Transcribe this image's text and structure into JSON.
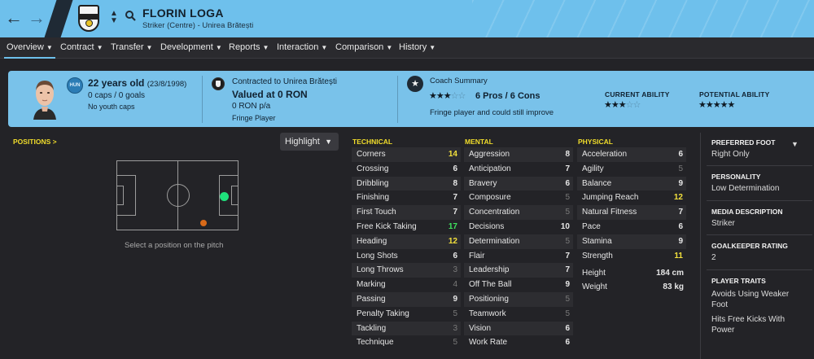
{
  "header": {
    "player_name": "FLORIN LOGA",
    "subtitle": "Striker (Centre) - Unirea Brătești",
    "header_color": "#6ec0ec"
  },
  "tabs": [
    {
      "label": "Overview",
      "active": true
    },
    {
      "label": "Contract"
    },
    {
      "label": "Transfer"
    },
    {
      "label": "Development"
    },
    {
      "label": "Reports"
    },
    {
      "label": "Interaction"
    },
    {
      "label": "Comparison"
    },
    {
      "label": "History"
    }
  ],
  "banner": {
    "nation_code": "HUN",
    "age": "22 years old",
    "dob": "(23/8/1998)",
    "caps": "0 caps / 0 goals",
    "youth_caps": "No youth caps",
    "contract": "Contracted to Unirea Brătești",
    "value": "Valued at 0 RON",
    "wage": "0 RON p/a",
    "status": "Fringe Player",
    "coach_title": "Coach Summary",
    "coach_stars": 3,
    "coach_pros_cons": "6 Pros / 6 Cons",
    "coach_summary": "Fringe player and could still improve",
    "current_ability_label": "CURRENT ABILITY",
    "current_ability_stars": 3,
    "potential_ability_label": "POTENTIAL ABILITY",
    "potential_ability_stars": 5
  },
  "positions": {
    "title": "POSITIONS >",
    "highlight_label": "Highlight",
    "hint": "Select a position on the pitch"
  },
  "technical": {
    "title": "TECHNICAL",
    "attrs": [
      {
        "name": "Corners",
        "value": "14"
      },
      {
        "name": "Crossing",
        "value": "6"
      },
      {
        "name": "Dribbling",
        "value": "8"
      },
      {
        "name": "Finishing",
        "value": "7"
      },
      {
        "name": "First Touch",
        "value": "7"
      },
      {
        "name": "Free Kick Taking",
        "value": "17"
      },
      {
        "name": "Heading",
        "value": "12"
      },
      {
        "name": "Long Shots",
        "value": "6"
      },
      {
        "name": "Long Throws",
        "value": "3"
      },
      {
        "name": "Marking",
        "value": "4"
      },
      {
        "name": "Passing",
        "value": "9"
      },
      {
        "name": "Penalty Taking",
        "value": "5"
      },
      {
        "name": "Tackling",
        "value": "3"
      },
      {
        "name": "Technique",
        "value": "5"
      }
    ]
  },
  "mental": {
    "title": "MENTAL",
    "attrs": [
      {
        "name": "Aggression",
        "value": "8"
      },
      {
        "name": "Anticipation",
        "value": "7"
      },
      {
        "name": "Bravery",
        "value": "6"
      },
      {
        "name": "Composure",
        "value": "5"
      },
      {
        "name": "Concentration",
        "value": "5"
      },
      {
        "name": "Decisions",
        "value": "10"
      },
      {
        "name": "Determination",
        "value": "5"
      },
      {
        "name": "Flair",
        "value": "7"
      },
      {
        "name": "Leadership",
        "value": "7"
      },
      {
        "name": "Off The Ball",
        "value": "9"
      },
      {
        "name": "Positioning",
        "value": "5"
      },
      {
        "name": "Teamwork",
        "value": "5"
      },
      {
        "name": "Vision",
        "value": "6"
      },
      {
        "name": "Work Rate",
        "value": "6"
      }
    ]
  },
  "physical": {
    "title": "PHYSICAL",
    "attrs": [
      {
        "name": "Acceleration",
        "value": "6"
      },
      {
        "name": "Agility",
        "value": "5"
      },
      {
        "name": "Balance",
        "value": "9"
      },
      {
        "name": "Jumping Reach",
        "value": "12"
      },
      {
        "name": "Natural Fitness",
        "value": "7"
      },
      {
        "name": "Pace",
        "value": "6"
      },
      {
        "name": "Stamina",
        "value": "9"
      },
      {
        "name": "Strength",
        "value": "11"
      }
    ],
    "height_label": "Height",
    "height": "184 cm",
    "weight_label": "Weight",
    "weight": "83 kg"
  },
  "side_panel": {
    "preferred_foot_label": "PREFERRED FOOT",
    "preferred_foot": "Right Only",
    "personality_label": "PERSONALITY",
    "personality": "Low Determination",
    "media_label": "MEDIA DESCRIPTION",
    "media": "Striker",
    "gk_rating_label": "GOALKEEPER RATING",
    "gk_rating": "2",
    "traits_label": "PLAYER TRAITS",
    "traits": [
      "Avoids Using Weaker Foot",
      "Hits Free Kicks With Power"
    ]
  }
}
